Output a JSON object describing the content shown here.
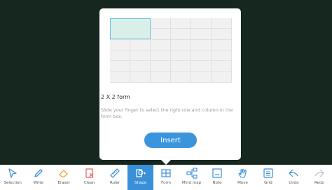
{
  "form_popup": {
    "title": "2 X 2 form",
    "description": "Slide your finger to select the right row and column in the form box.",
    "insert_label": "Insert"
  },
  "toolbar": {
    "tools": [
      {
        "label": "Selection",
        "icon": "selection-icon"
      },
      {
        "label": "Write",
        "icon": "pen-icon"
      },
      {
        "label": "Eraser",
        "icon": "eraser-icon"
      },
      {
        "label": "Clean",
        "icon": "clean-icon"
      },
      {
        "label": "Ruler",
        "icon": "ruler-icon"
      },
      {
        "label": "Shape",
        "icon": "shape-icon"
      },
      {
        "label": "Form",
        "icon": "table-icon"
      },
      {
        "label": "Mind map",
        "icon": "mind-map-icon"
      },
      {
        "label": "Note",
        "icon": "note-icon"
      },
      {
        "label": "Move",
        "icon": "hand-icon"
      },
      {
        "label": "Grid",
        "icon": "grid-icon"
      },
      {
        "label": "Undo",
        "icon": "undo-icon"
      },
      {
        "label": "Redo",
        "icon": "redo-icon"
      }
    ],
    "active_tool": "Shape",
    "colors": {
      "icon": "#3a8fd9",
      "eraser": "#f0a53a",
      "clean": "#e85b5b",
      "active_bg": "#3a8fd9"
    }
  }
}
